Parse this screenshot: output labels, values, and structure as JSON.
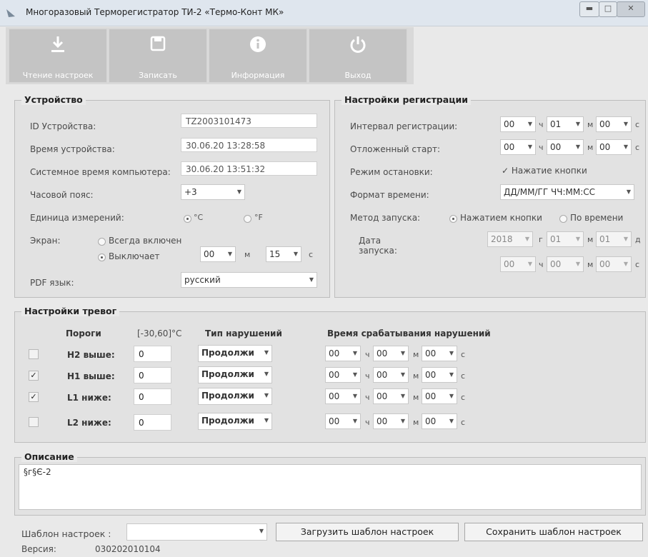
{
  "window": {
    "title": "Многоразовый Терморегистратор ТИ-2 «Термо-Конт МК»"
  },
  "toolbar": [
    {
      "label": "Чтение настроек",
      "icon": "download-icon"
    },
    {
      "label": "Записать",
      "icon": "save-icon"
    },
    {
      "label": "Информация",
      "icon": "info-icon"
    },
    {
      "label": "Выход",
      "icon": "power-icon"
    }
  ],
  "device": {
    "title": "Устройство",
    "id_label": "ID Устройства:",
    "id_value": "TZ2003101473",
    "time_label": "Время устройства:",
    "time_value": "30.06.20 13:28:58",
    "pc_time_label": "Системное время компьютера:",
    "pc_time_value": "30.06.20 13:51:32",
    "tz_label": "Часовой пояс:",
    "tz_value": "+3",
    "units_label": "Единица измерений:",
    "unit_c": "°C",
    "unit_f": "°F",
    "screen_label": "Экран:",
    "screen_always": "Всегда включен",
    "screen_off": "Выключает",
    "screen_min": "00",
    "screen_min_unit": "м",
    "screen_sec": "15",
    "screen_sec_unit": "с",
    "pdf_label": "PDF язык:",
    "pdf_value": "русский"
  },
  "registration": {
    "title": "Настройки регистрации",
    "interval_label": "Интервал регистрации:",
    "interval": {
      "h": "00",
      "m": "01",
      "s": "00"
    },
    "delay_label": "Отложенный старт:",
    "delay": {
      "h": "00",
      "m": "00",
      "s": "00"
    },
    "u_h": "ч",
    "u_m": "м",
    "u_s": "с",
    "u_y": "г",
    "u_d": "д",
    "stop_label": "Режим остановки:",
    "stop_value": "Нажатие кнопки",
    "stop_mark": "✓",
    "format_label": "Формат времени:",
    "format_value": "ДД/ММ/ГГ ЧЧ:ММ:СС",
    "start_label": "Метод запуска:",
    "start_button": "Нажатием кнопки",
    "start_time": "По времени",
    "date_label_1": "Дата",
    "date_label_2": "запуска:",
    "date": {
      "y": "2018",
      "mo": "01",
      "d": "01"
    },
    "start_time_val": {
      "h": "00",
      "m": "00",
      "s": "00"
    }
  },
  "alarms": {
    "title": "Настройки тревог",
    "col_thresholds": "Пороги",
    "col_range": "[-30,60]°С",
    "col_type": "Тип нарушений",
    "col_time": "Время срабатывания нарушений",
    "u_h": "ч",
    "u_m": "м",
    "u_s": "с",
    "rows": [
      {
        "label": "H2 выше:",
        "checked": "",
        "value": "0",
        "type": "Продолжи",
        "h": "00",
        "m": "00",
        "s": "00"
      },
      {
        "label": "H1 выше:",
        "checked": "✓",
        "value": "0",
        "type": "Продолжи",
        "h": "00",
        "m": "00",
        "s": "00"
      },
      {
        "label": "L1 ниже:",
        "checked": "✓",
        "value": "0",
        "type": "Продолжи",
        "h": "00",
        "m": "00",
        "s": "00"
      },
      {
        "label": "L2 ниже:",
        "checked": "",
        "value": "0",
        "type": "Продолжи",
        "h": "00",
        "m": "00",
        "s": "00"
      }
    ]
  },
  "description": {
    "title": "Описание",
    "text": "§г§Є-2"
  },
  "footer": {
    "template_label": "Шаблон настроек :",
    "template_value": "",
    "load_button": "Загрузить шаблон настроек",
    "save_button": "Сохранить шаблон настроек",
    "version_label": "Версия:",
    "version_value": "030202010104"
  },
  "colors": {
    "toolbar_tile": "#c4c4c4",
    "panel": "#e2e2e2",
    "titlebar": "#dfe6ee"
  }
}
